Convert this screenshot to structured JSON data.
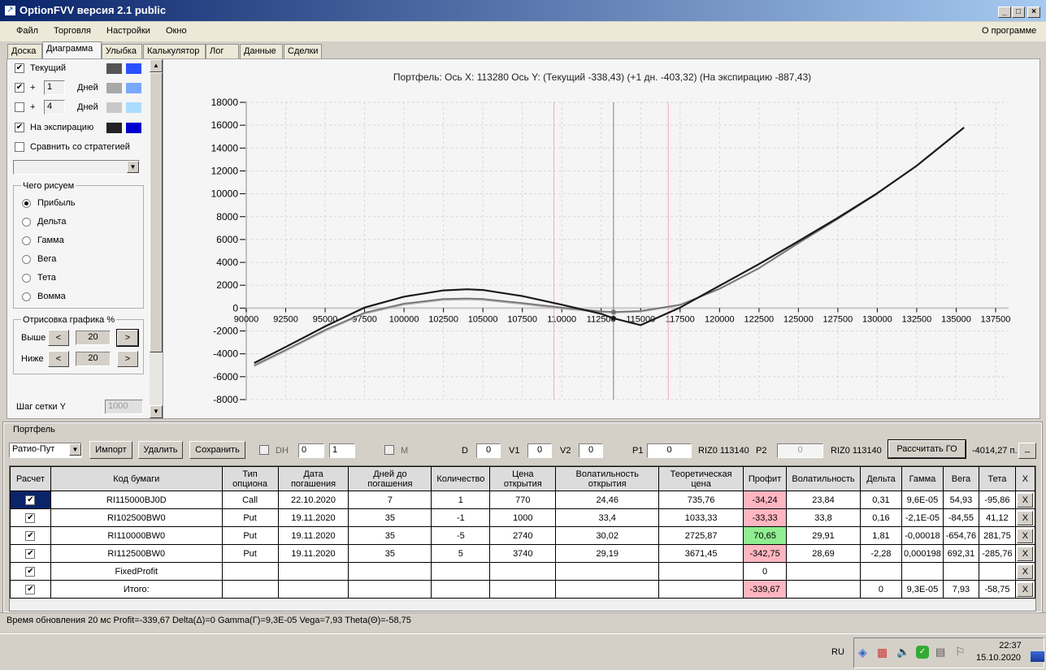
{
  "window": {
    "title": "OptionFVV версия 2.1 public",
    "min": "_",
    "max": "□",
    "close": "×"
  },
  "menu": [
    "Файл",
    "Торговля",
    "Настройки",
    "Окно"
  ],
  "menu_about": "О программе",
  "tabs": [
    "Доска",
    "Диаграмма",
    "Улыбка",
    "Калькулятор",
    "Лог",
    "Данные",
    "Сделки"
  ],
  "left": {
    "lines": [
      {
        "label": "Текущий",
        "checked": true,
        "days": "",
        "c1": "#555555",
        "c2": "#2b50ff"
      },
      {
        "label": "Дней",
        "checked": true,
        "days": "1",
        "c1": "#a8a8a8",
        "c2": "#7aa8ff"
      },
      {
        "label": "Дней",
        "checked": false,
        "days": "4",
        "c1": "#c8c8c8",
        "c2": "#aaddff"
      },
      {
        "label": "На экспирацию",
        "checked": true,
        "days": "",
        "c1": "#222222",
        "c2": "#0000cc"
      }
    ],
    "plus": "+",
    "compare": "Сравнить со стратегией",
    "what_title": "Чего рисуем",
    "radios": [
      "Прибыль",
      "Дельта",
      "Гамма",
      "Вега",
      "Тета",
      "Вомма"
    ],
    "selected_radio": 0,
    "range_title": "Отрисовка графика %",
    "above_label": "Выше",
    "above_value": "20",
    "below_label": "Ниже",
    "below_value": "20",
    "grid_step_label": "Шаг сетки Y",
    "grid_step_value": "1000",
    "prev": "<",
    "next": ">"
  },
  "chart_header": "Портфель: Ось X: 113280 Ось Y:  (Текущий -338,43)  (+1 дн. -403,32)  (На экспирацию -887,43)",
  "chart_data": {
    "type": "line",
    "xlim": [
      90000,
      137500
    ],
    "ylim": [
      -8000,
      18000
    ],
    "xticks": [
      90000,
      92500,
      95000,
      97500,
      100000,
      102500,
      105000,
      107500,
      110000,
      112500,
      115000,
      117500,
      120000,
      122500,
      125000,
      127500,
      130000,
      132500,
      135000,
      137500
    ],
    "yticks": [
      18000,
      16000,
      14000,
      12000,
      10000,
      8000,
      6000,
      4000,
      2000,
      0,
      -2000,
      -4000,
      -6000,
      -8000
    ],
    "cursor_x": 113280,
    "range_lines": [
      109500,
      116750
    ],
    "series": [
      {
        "name": "+1 дн.",
        "color": "#b0b0b0",
        "points": [
          [
            90500,
            -5100
          ],
          [
            92500,
            -3750
          ],
          [
            95000,
            -2000
          ],
          [
            97500,
            -500
          ],
          [
            100000,
            300
          ],
          [
            102500,
            700
          ],
          [
            104000,
            750
          ],
          [
            105000,
            700
          ],
          [
            107500,
            350
          ],
          [
            110000,
            -50
          ],
          [
            112500,
            -360
          ],
          [
            113280,
            -403
          ],
          [
            115000,
            -320
          ],
          [
            117500,
            250
          ],
          [
            120000,
            1650
          ],
          [
            122500,
            3450
          ],
          [
            125000,
            5650
          ],
          [
            127500,
            7800
          ],
          [
            130000,
            10000
          ]
        ]
      },
      {
        "name": "Текущий",
        "color": "#707070",
        "points": [
          [
            90500,
            -5000
          ],
          [
            92500,
            -3650
          ],
          [
            95000,
            -1900
          ],
          [
            97500,
            -400
          ],
          [
            100000,
            400
          ],
          [
            102500,
            800
          ],
          [
            104000,
            850
          ],
          [
            105000,
            800
          ],
          [
            107500,
            450
          ],
          [
            110000,
            50
          ],
          [
            112500,
            -280
          ],
          [
            113280,
            -338
          ],
          [
            115000,
            -250
          ],
          [
            117500,
            300
          ],
          [
            120000,
            1700
          ],
          [
            122500,
            3500
          ],
          [
            125000,
            5700
          ],
          [
            127500,
            7800
          ],
          [
            130000,
            10000
          ]
        ]
      },
      {
        "name": "На экспирацию",
        "color": "#1a1a1a",
        "points": [
          [
            90500,
            -4800
          ],
          [
            92500,
            -3400
          ],
          [
            95000,
            -1600
          ],
          [
            97500,
            50
          ],
          [
            100000,
            1000
          ],
          [
            102500,
            1550
          ],
          [
            104000,
            1650
          ],
          [
            105000,
            1580
          ],
          [
            107500,
            1050
          ],
          [
            110000,
            300
          ],
          [
            112500,
            -500
          ],
          [
            113280,
            -887
          ],
          [
            115000,
            -1490
          ],
          [
            117500,
            50
          ],
          [
            120000,
            1950
          ],
          [
            122500,
            3850
          ],
          [
            125000,
            5850
          ],
          [
            127500,
            7900
          ],
          [
            130000,
            10050
          ],
          [
            132500,
            12450
          ],
          [
            135500,
            15800
          ]
        ]
      }
    ]
  },
  "portfolio": {
    "title": "Портфель",
    "strategy": "Ратио-Пут",
    "import": "Импорт",
    "delete": "Удалить",
    "save": "Сохранить",
    "dh": "DH",
    "spin1": "0",
    "spin2": "1",
    "m": "M",
    "d_label": "D",
    "d": "0",
    "v1_label": "V1",
    "v1": "0",
    "v2_label": "V2",
    "v2": "0",
    "p1_label": "P1",
    "p1": "0",
    "p1_info": "RIZ0 113140",
    "p2_label": "P2",
    "p2": "0",
    "p2_info": "RIZ0 113140",
    "calc_go": "Рассчитать ГО",
    "go_value": "-4014,27 п.",
    "collapse": "_"
  },
  "table": {
    "headers": [
      "Расчет",
      "Код бумаги",
      "Тип\nопциона",
      "Дата\nпогашения",
      "Дней до\nпогашения",
      "Количество",
      "Цена\nоткрытия",
      "Волатильность\nоткрытия",
      "Теоретическая\nцена",
      "Профит",
      "Волатильность",
      "Дельта",
      "Гамма",
      "Вега",
      "Тета",
      "X"
    ],
    "rows": [
      [
        "RI115000BJ0D",
        "Call",
        "22.10.2020",
        "7",
        "1",
        "770",
        "24,46",
        "735,76",
        "-34,24",
        "23,84",
        "0,31",
        "9,6E-05",
        "54,93",
        "-95,86"
      ],
      [
        "RI102500BW0",
        "Put",
        "19.11.2020",
        "35",
        "-1",
        "1000",
        "33,4",
        "1033,33",
        "-33,33",
        "33,8",
        "0,16",
        "-2,1E-05",
        "-84,55",
        "41,12"
      ],
      [
        "RI110000BW0",
        "Put",
        "19.11.2020",
        "35",
        "-5",
        "2740",
        "30,02",
        "2725,87",
        "70,65",
        "29,91",
        "1,81",
        "-0,00018",
        "-654,76",
        "281,75"
      ],
      [
        "RI112500BW0",
        "Put",
        "19.11.2020",
        "35",
        "5",
        "3740",
        "29,19",
        "3671,45",
        "-342,75",
        "28,69",
        "-2,28",
        "0,000198",
        "692,31",
        "-285,76"
      ],
      [
        "FixedProfit",
        "",
        "",
        "",
        "",
        "",
        "",
        "",
        "0",
        "",
        "",
        "",
        "",
        ""
      ],
      [
        "Итого:",
        "",
        "",
        "",
        "",
        "",
        "",
        "",
        "-339,67",
        "",
        "0",
        "9,3E-05",
        "7,93",
        "-58,75"
      ]
    ],
    "x": "X",
    "check": "✔"
  },
  "status": "Время обновления 20 мс  Profit=-339,67 Delta(Δ)=0 Gamma(Γ)=9,3E-05 Vega=7,93 Theta(Θ)=-58,75",
  "tray": {
    "lang": "RU",
    "time": "22:37",
    "date": "15.10.2020"
  }
}
